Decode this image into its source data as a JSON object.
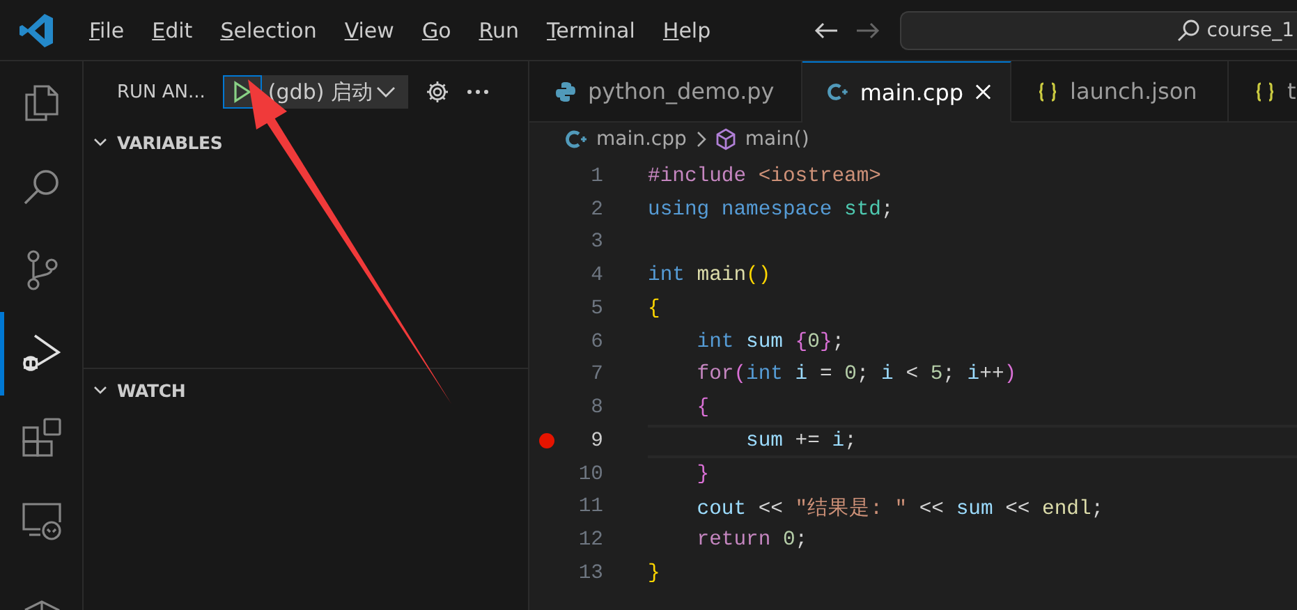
{
  "menu": [
    {
      "label": "File"
    },
    {
      "label": "Edit"
    },
    {
      "label": "Selection"
    },
    {
      "label": "View"
    },
    {
      "label": "Go"
    },
    {
      "label": "Run"
    },
    {
      "label": "Terminal"
    },
    {
      "label": "Help"
    }
  ],
  "search": {
    "value": "course_1"
  },
  "activity_bar": [
    {
      "selected": false
    },
    {
      "selected": false
    },
    {
      "selected": false
    },
    {
      "selected": true
    },
    {
      "selected": false
    },
    {
      "selected": false
    },
    {
      "selected": false
    }
  ],
  "run_panel": {
    "title": "RUN AN...",
    "configuration": "(gdb) 启动",
    "sections": [
      {
        "label": "VARIABLES",
        "expanded": true
      },
      {
        "label": "WATCH",
        "expanded": true
      }
    ]
  },
  "tabs": [
    {
      "label": "python_demo.py",
      "kind": "python",
      "selected": false
    },
    {
      "label": "main.cpp",
      "kind": "cpp",
      "selected": true
    },
    {
      "label": "launch.json",
      "kind": "json",
      "selected": false
    },
    {
      "label": "t",
      "kind": "json",
      "selected": false
    }
  ],
  "breadcrumb": [
    {
      "label": "main.cpp",
      "kind": "cpp"
    },
    {
      "label": "main()",
      "kind": "method"
    }
  ],
  "code": [
    {
      "number": "1",
      "breakpoint": false,
      "current": false,
      "tokens": [
        {
          "text": "#include",
          "kind": "control"
        },
        {
          "text": " <iostream>",
          "kind": "string"
        }
      ]
    },
    {
      "number": "2",
      "breakpoint": false,
      "current": false,
      "tokens": [
        {
          "text": "using",
          "kind": "keyword"
        },
        {
          "text": " namespace",
          "kind": "keyword"
        },
        {
          "text": " std",
          "kind": "type"
        },
        {
          "text": ";",
          "kind": "plain"
        }
      ]
    },
    {
      "number": "3",
      "breakpoint": false,
      "current": false
    },
    {
      "number": "4",
      "breakpoint": false,
      "current": false,
      "tokens": [
        {
          "text": "int",
          "kind": "keyword"
        },
        {
          "text": " main",
          "kind": "function"
        },
        {
          "text": "()",
          "kind": "bracket1"
        }
      ]
    },
    {
      "number": "5",
      "breakpoint": false,
      "current": false,
      "tokens": [
        {
          "text": "{",
          "kind": "bracket1"
        }
      ]
    },
    {
      "number": "6",
      "breakpoint": false,
      "current": false,
      "tokens": [
        {
          "text": "    int",
          "kind": "keyword"
        },
        {
          "text": " sum",
          "kind": "variable"
        },
        {
          "text": " {",
          "kind": "bracket2"
        },
        {
          "text": "0",
          "kind": "number"
        },
        {
          "text": "}",
          "kind": "bracket2"
        },
        {
          "text": ";",
          "kind": "plain"
        }
      ]
    },
    {
      "number": "7",
      "breakpoint": false,
      "current": false,
      "tokens": [
        {
          "text": "    for",
          "kind": "control"
        },
        {
          "text": "(",
          "kind": "bracket2"
        },
        {
          "text": "int",
          "kind": "keyword"
        },
        {
          "text": " i",
          "kind": "variable"
        },
        {
          "text": " = ",
          "kind": "plain"
        },
        {
          "text": "0",
          "kind": "number"
        },
        {
          "text": "; ",
          "kind": "plain"
        },
        {
          "text": "i",
          "kind": "variable"
        },
        {
          "text": " < ",
          "kind": "plain"
        },
        {
          "text": "5",
          "kind": "number"
        },
        {
          "text": "; ",
          "kind": "plain"
        },
        {
          "text": "i",
          "kind": "variable"
        },
        {
          "text": "++",
          "kind": "plain"
        },
        {
          "text": ")",
          "kind": "bracket2"
        }
      ]
    },
    {
      "number": "8",
      "breakpoint": false,
      "current": false,
      "tokens": [
        {
          "text": "    {",
          "kind": "bracket2"
        }
      ]
    },
    {
      "number": "9",
      "breakpoint": true,
      "current": true,
      "tokens": [
        {
          "text": "        sum",
          "kind": "variable"
        },
        {
          "text": " += ",
          "kind": "plain"
        },
        {
          "text": "i",
          "kind": "variable"
        },
        {
          "text": ";",
          "kind": "plain"
        }
      ]
    },
    {
      "number": "10",
      "breakpoint": false,
      "current": false,
      "tokens": [
        {
          "text": "    }",
          "kind": "bracket2"
        }
      ]
    },
    {
      "number": "11",
      "breakpoint": false,
      "current": false,
      "tokens": [
        {
          "text": "    cout",
          "kind": "variable"
        },
        {
          "text": " << ",
          "kind": "plain"
        },
        {
          "text": "\"结果是: \"",
          "kind": "string"
        },
        {
          "text": " << ",
          "kind": "plain"
        },
        {
          "text": "sum",
          "kind": "variable"
        },
        {
          "text": " << ",
          "kind": "plain"
        },
        {
          "text": "endl",
          "kind": "function"
        },
        {
          "text": ";",
          "kind": "plain"
        }
      ]
    },
    {
      "number": "12",
      "breakpoint": false,
      "current": false,
      "tokens": [
        {
          "text": "    return",
          "kind": "control"
        },
        {
          "text": " 0",
          "kind": "number"
        },
        {
          "text": ";",
          "kind": "plain"
        }
      ]
    },
    {
      "number": "13",
      "breakpoint": false,
      "current": false,
      "tokens": [
        {
          "text": "}",
          "kind": "bracket1"
        }
      ]
    }
  ]
}
